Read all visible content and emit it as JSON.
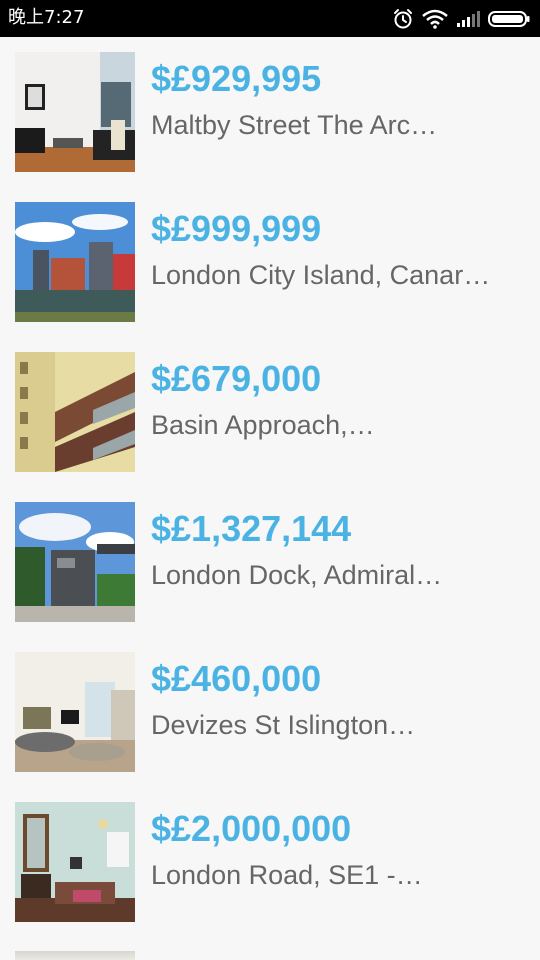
{
  "status_bar": {
    "time": "晚上7:27",
    "icons": [
      "alarm-icon",
      "wifi-icon",
      "signal-icon",
      "battery-icon"
    ]
  },
  "listings": [
    {
      "price": "$£929,995",
      "address": "Maltby Street The Arc…"
    },
    {
      "price": "$£999,999",
      "address": "London City Island, Canar…"
    },
    {
      "price": "$£679,000",
      "address": "Basin Approach,…"
    },
    {
      "price": "$£1,327,144",
      "address": "London Dock, Admiral…"
    },
    {
      "price": "$£460,000",
      "address": "Devizes St Islington…"
    },
    {
      "price": "$£2,000,000",
      "address": "London Road, SE1 -…"
    }
  ],
  "colors": {
    "price": "#4bb3e3",
    "address": "#666666",
    "background": "#f7f7f7",
    "status_bar": "#000000"
  }
}
